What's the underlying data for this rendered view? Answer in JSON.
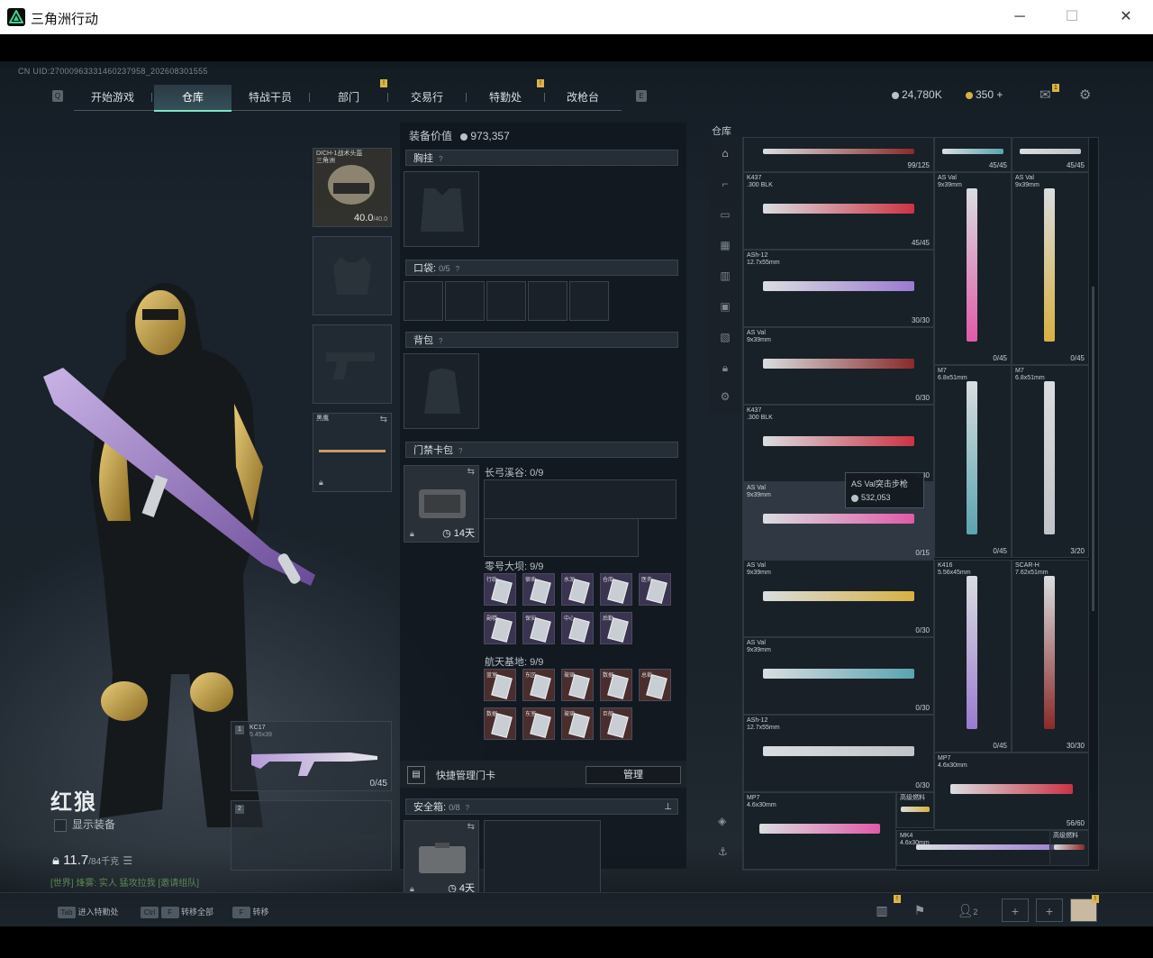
{
  "window": {
    "title": "三角洲行动",
    "minimize": "─",
    "maximize": "☐",
    "close": "✕"
  },
  "uid": "CN UID:270009633314602379​58_202608301555",
  "nav": {
    "key_left": "Q",
    "key_right": "E",
    "tabs": [
      {
        "label": "开始游戏"
      },
      {
        "label": "仓库",
        "active": true
      },
      {
        "label": "特战干员"
      },
      {
        "label": "部门",
        "badge": "!"
      },
      {
        "label": "交易行"
      },
      {
        "label": "特勤处",
        "badge": "!"
      },
      {
        "label": "改枪台"
      }
    ]
  },
  "currency": {
    "hafu": "24,780K",
    "coupons": "350",
    "plus": "+",
    "mail_badge": "1"
  },
  "character": {
    "name": "红狼",
    "show_equipment": "显示装备",
    "weight": "11.7",
    "weight_max": "/84千克",
    "tagline": "[世界] 烽雾: 实人 猛攻拉我 [邀请组队]"
  },
  "equipment": {
    "helmet_name": "DICH-1战术头盔",
    "helmet_sub": "三角洲",
    "helmet_durability": "40.0",
    "helmet_durability_max": "/40.0",
    "melee_label": "黑鹰",
    "primary_name": "KC17",
    "primary_caliber": "5.45x39",
    "primary_ammo": "0/45",
    "secondary_slot": "2",
    "primary_slot": "1"
  },
  "mid": {
    "value_label": "装备价值",
    "value": "973,357",
    "chest_label": "胸挂",
    "pocket_label": "口袋:",
    "pocket_count": "0/5",
    "backpack_label": "背包",
    "keycard_label": "门禁卡包",
    "keycard_days": "14天",
    "map1_label": "长弓溪谷: 0/9",
    "map2_label": "零号大坝: 9/9",
    "map3_label": "航天基地: 9/9",
    "map2_cards": [
      "行政",
      "宿舍",
      "水泥",
      "仓库",
      "医务",
      "副楼",
      "保安",
      "中心",
      "后勤"
    ],
    "map3_cards": [
      "蓝室",
      "东区",
      "玻璃",
      "数据",
      "总裁",
      "数据",
      "东室",
      "玻璃",
      "巨舰"
    ],
    "quick_label": "快捷管理门卡",
    "manage_btn": "管理",
    "safe_label": "安全箱:",
    "safe_count": "0/8",
    "safe_days": "4天",
    "question": "?"
  },
  "warehouse": {
    "title": "仓库",
    "tooltip_name": "AS Val突击步枪",
    "tooltip_price": "532,053",
    "items": [
      {
        "name": "",
        "count": "99/125"
      },
      {
        "name": "",
        "count": "45/45"
      },
      {
        "name": "",
        "count": "45/45"
      },
      {
        "name": "K437\n.300 BLK",
        "count": "45/45"
      },
      {
        "name": "AS Val\n9x39mm",
        "count": "0/45"
      },
      {
        "name": "AS Val\n9x39mm",
        "count": "0/45"
      },
      {
        "name": "ASh-12\n12.7x55mm",
        "count": "30/30"
      },
      {
        "name": "AS Val\n9x39mm",
        "count": "0/30"
      },
      {
        "name": "M7\n6.8x51mm",
        "count": "0/45"
      },
      {
        "name": "M7\n6.8x51mm",
        "count": "3/20"
      },
      {
        "name": "K437\n.300 BLK",
        "count": "0/30"
      },
      {
        "name": "AS Val\n9x39mm",
        "count": "0/15"
      },
      {
        "name": "AS Val\n9x39mm",
        "count": "0/30"
      },
      {
        "name": "K416\n5.56x45mm",
        "count": "0/45"
      },
      {
        "name": "SCAR-H\n7.62x51mm",
        "count": "30/30"
      },
      {
        "name": "AS Val\n9x39mm",
        "count": "0/30"
      },
      {
        "name": "ASh-12\n12.7x55mm",
        "count": "0/30"
      },
      {
        "name": "MP7\n4.6x30mm",
        "count": "56/60"
      },
      {
        "name": "MP7\n4.6x30mm",
        "count": ""
      },
      {
        "name": "高级燃料",
        "count": ""
      },
      {
        "name": "MK4\n4.6x30mm",
        "count": ""
      },
      {
        "name": "高级燃料",
        "count": ""
      }
    ]
  },
  "bottom": {
    "hints": [
      {
        "key": "Tab",
        "label": "进入特勤处"
      },
      {
        "key": "Ctrl",
        "key2": "F",
        "label": "转移全部"
      },
      {
        "key": "F",
        "label": "转移"
      }
    ],
    "team_count": "2",
    "badge": "!"
  },
  "colors": {
    "accent": "#7fe3c4",
    "badge": "#d9b44a",
    "panel": "#12181e"
  }
}
